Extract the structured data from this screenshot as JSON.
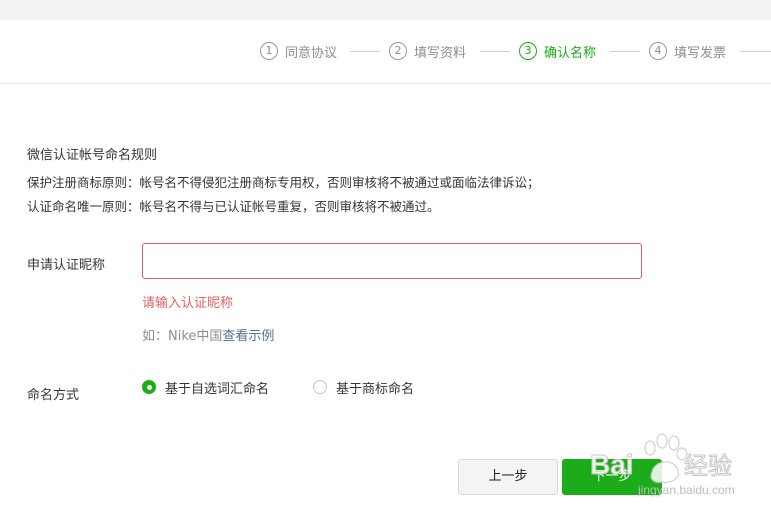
{
  "steps": [
    {
      "num": "1",
      "label": "同意协议",
      "active": false
    },
    {
      "num": "2",
      "label": "填写资料",
      "active": false
    },
    {
      "num": "3",
      "label": "确认名称",
      "active": true
    },
    {
      "num": "4",
      "label": "填写发票",
      "active": false
    }
  ],
  "rules": {
    "title": "微信认证帐号命名规则",
    "line1": "保护注册商标原则：帐号名不得侵犯注册商标专用权，否则审核将不被通过或面临法律诉讼；",
    "line2": "认证命名唯一原则：帐号名不得与已认证帐号重复，否则审核将不被通过。"
  },
  "nickname": {
    "label": "申请认证昵称",
    "value": "",
    "error": "请输入认证昵称",
    "hint_prefix": "如：Nike中国",
    "hint_link": "查看示例"
  },
  "naming": {
    "label": "命名方式",
    "options": [
      {
        "label": "基于自选词汇命名",
        "checked": true
      },
      {
        "label": "基于商标命名",
        "checked": false
      }
    ]
  },
  "buttons": {
    "prev": "上一步",
    "next": "下一步"
  },
  "watermark": {
    "brand": "Bai",
    "brand_cn": "经验",
    "url": "jingyan.baidu.com"
  },
  "colors": {
    "accent": "#1aad19",
    "error": "#e15f63",
    "link": "#576b95"
  }
}
